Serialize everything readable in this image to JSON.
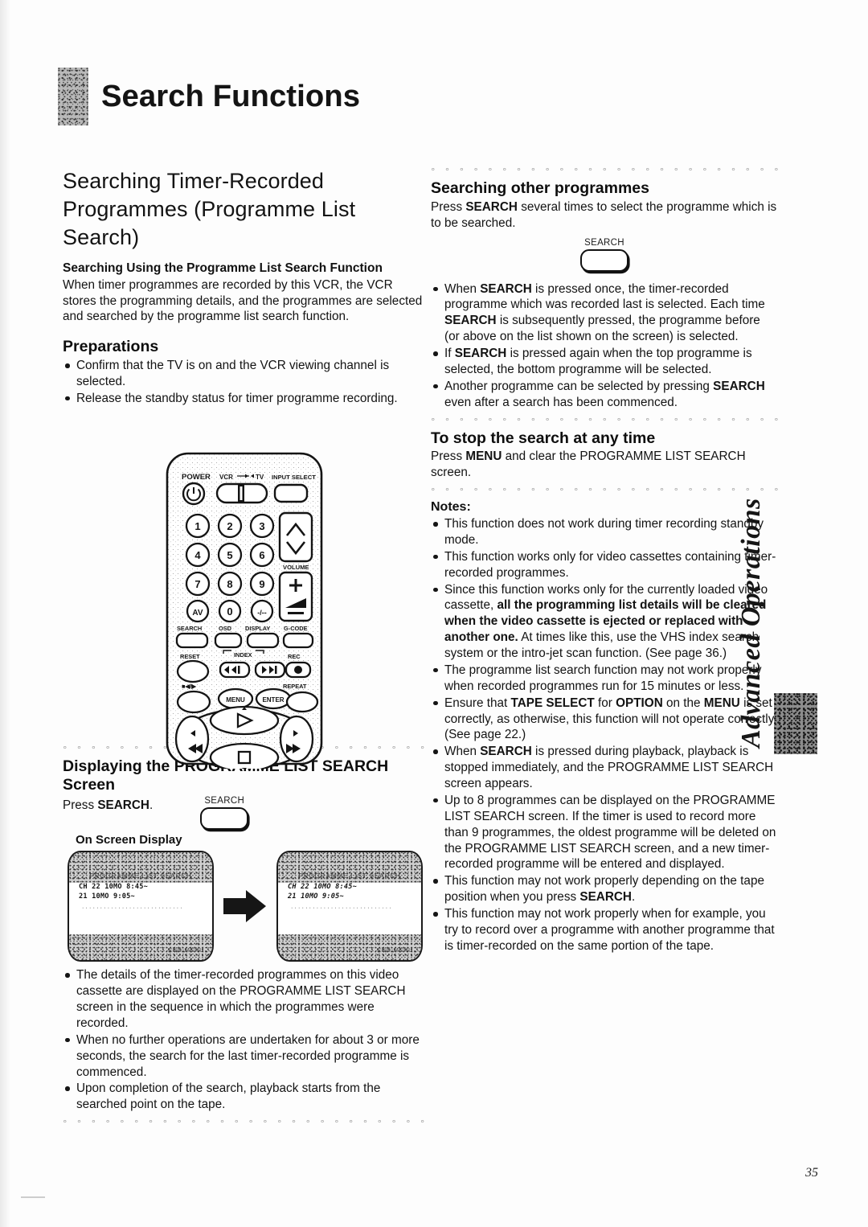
{
  "chapter": {
    "title": "Search Functions"
  },
  "left": {
    "heading": "Searching Timer-Recorded Programmes (Programme List Search)",
    "subheading": "Searching Using the Programme List Search Function",
    "intro": "When timer programmes are recorded by this VCR, the VCR stores the programming details, and the programmes are selected and searched by the programme list search function.",
    "preparations_heading": "Preparations",
    "preparations": [
      "Confirm that the TV is on and the VCR viewing channel is selected.",
      "Release the standby status for timer programme recording."
    ],
    "displaying_heading": "Displaying the PROGRAMME LIST SEARCH Screen",
    "press_search_pre": "Press ",
    "press_search_bold": "SEARCH",
    "press_search_post": ".",
    "search_key_label": "SEARCH",
    "osd_heading": "On Screen Display",
    "osd_screen_1": {
      "title": "PROGRAMME LIST SEARCH",
      "rows": [
        "CH  22 10MO  8:45~",
        "    21 10MO  9:05~"
      ],
      "footer": "END:MENU"
    },
    "osd_screen_2": {
      "title": "PROGRAMME LIST SEARCH",
      "rows": [
        "CH  22 10MO  8:45~",
        "    21 10MO  9:05~"
      ],
      "footer": "END:MENU"
    },
    "notes": [
      "The details of the timer-recorded programmes on this video cassette are displayed on the PROGRAMME LIST SEARCH screen in the sequence in which the programmes were recorded.",
      "When no further operations are undertaken for about 3 or more seconds, the search for the last timer-recorded programme is commenced.",
      "Upon completion of the search, playback starts from the searched point on the tape."
    ]
  },
  "right": {
    "other_heading": "Searching other programmes",
    "other_intro_pre": "Press ",
    "other_intro_bold": "SEARCH",
    "other_intro_post": " several times to select the programme which is to be searched.",
    "search_key_label": "SEARCH",
    "other_bullets": [
      "When SEARCH is pressed once, the timer-recorded programme which was recorded last is selected. Each time SEARCH is subsequently pressed, the programme before (or above on the list shown on the screen) is selected.",
      "If SEARCH is pressed again when the top programme is selected, the bottom programme will be selected.",
      "Another programme can be selected by pressing SEARCH even after a search has been commenced."
    ],
    "stop_heading": "To stop the search at any time",
    "stop_text_pre": "Press ",
    "stop_text_bold": "MENU",
    "stop_text_post": " and clear the PROGRAMME LIST SEARCH screen.",
    "notes_heading": "Notes:",
    "notes": [
      "This function does not work during timer recording standby mode.",
      "This function works only for video cassettes containing timer-recorded programmes.",
      "Since this function works only for the currently loaded video cassette, all the programming list details will be cleared when the video cassette is ejected or replaced with another one. At times like this, use the VHS index search system or the intro-jet scan function. (See page 36.)",
      "The programme list search function may not work properly when recorded programmes run for 15 minutes or less.",
      "Ensure that TAPE SELECT for OPTION on the MENU is set correctly, as otherwise, this function will not operate correctly. (See page 22.)",
      "When SEARCH is pressed during playback, playback is stopped immediately, and the PROGRAMME LIST SEARCH screen appears.",
      "Up to 8 programmes can be displayed on the PROGRAMME LIST SEARCH screen. If the timer is used to record more than 9 programmes, the oldest programme will be deleted on the PROGRAMME LIST SEARCH screen, and a new timer-recorded programme will be entered and displayed.",
      "This function may not work properly depending on the tape position when you press SEARCH.",
      "This function may not work properly when for example, you try to record over a programme with another programme that is timer-recorded on the same portion of the tape."
    ]
  },
  "remote": {
    "labels": {
      "power": "POWER",
      "vcr_tv": "VCR → ←TV",
      "input_select": "INPUT SELECT",
      "volume": "VOLUME",
      "search": "SEARCH",
      "osd": "OSD",
      "display": "DISPLAY",
      "gcode": "G-CODE",
      "reset": "RESET",
      "index": "INDEX",
      "rec": "REC",
      "eject": "EJECT",
      "menu": "MENU",
      "enter": "ENTER",
      "repeat": "REPEAT"
    },
    "numbers": [
      "1",
      "2",
      "3",
      "4",
      "5",
      "6",
      "7",
      "8",
      "9",
      "AV",
      "0",
      "-/--"
    ]
  },
  "sidetab": {
    "label": "Advanced Operations"
  },
  "footer": {
    "page_number": "35"
  },
  "separator_dots": "° ° ° ° ° ° ° ° ° ° ° ° ° ° ° ° ° ° ° ° ° ° ° ° ° ° ° ° ° ° ° ° ° ° ° ° ° ° ° ° ° ° ° ° ° ° °",
  "osd_dotline": "····························"
}
